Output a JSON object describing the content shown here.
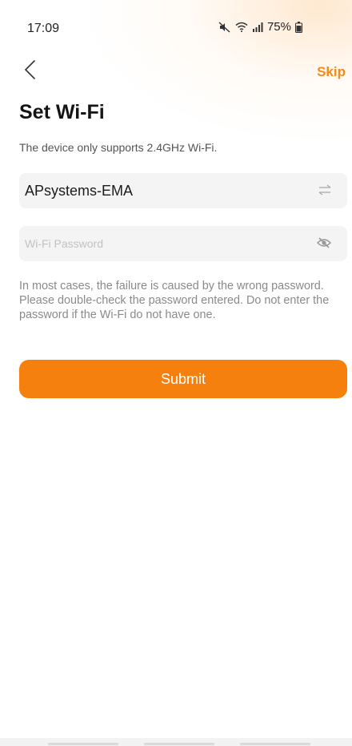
{
  "status_bar": {
    "time": "17:09",
    "battery": "75%",
    "icons": [
      "mute-icon",
      "wifi-icon",
      "signal-icon",
      "battery-icon"
    ]
  },
  "header": {
    "back_icon": "chevron-left-icon",
    "skip_label": "Skip"
  },
  "title": "Set Wi-Fi",
  "subtitle": "The device only supports 2.4GHz Wi-Fi.",
  "ssid_field": {
    "value": "APsystems-EMA",
    "icon": "switch-arrows-icon"
  },
  "password_field": {
    "value": "",
    "placeholder": "Wi-Fi Password",
    "icon": "eye-off-icon"
  },
  "hint": "In most cases, the failure is caused by the wrong password. Please double-check the password entered. Do not enter the password if the Wi-Fi do not have one.",
  "submit_label": "Submit",
  "colors": {
    "accent": "#f6800d",
    "skip": "#f08c1a"
  }
}
